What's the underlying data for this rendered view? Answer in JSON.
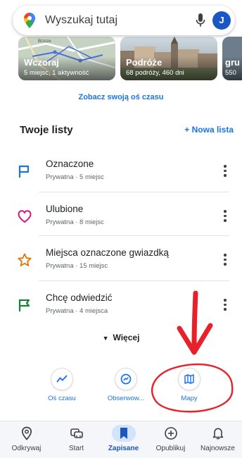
{
  "search": {
    "placeholder": "Wyszukaj tutaj",
    "avatar_letter": "J"
  },
  "timeline_cards": [
    {
      "title": "Wczoraj",
      "subtitle": "5 miejsc, 1 aktywność"
    },
    {
      "title": "Podróże",
      "subtitle": "68 podróży, 460 dni"
    },
    {
      "title": "gru",
      "subtitle": "550"
    }
  ],
  "map_thumbnail_label": "Brzoze",
  "timeline_link": "Zobacz swoją oś czasu",
  "lists": {
    "title": "Twoje listy",
    "new_list": "+ Nowa lista",
    "items": [
      {
        "name": "Oznaczone",
        "meta": "Prywatna · 5 miejsc",
        "icon": "flag-outline-icon",
        "color": "#1a73e8"
      },
      {
        "name": "Ulubione",
        "meta": "Prywatna · 8 miejsc",
        "icon": "heart-icon",
        "color": "#d01884"
      },
      {
        "name": "Miejsca oznaczone gwiazdką",
        "meta": "Prywatna · 15 miejsc",
        "icon": "star-icon",
        "color": "#e37400"
      },
      {
        "name": "Chcę odwiedzić",
        "meta": "Prywatna · 4 miejsca",
        "icon": "green-flag-icon",
        "color": "#188038"
      }
    ]
  },
  "more_label": "Więcej",
  "quick_actions": [
    {
      "label": "Oś czasu",
      "icon": "timeline-icon"
    },
    {
      "label": "Obserwow...",
      "icon": "follow-icon"
    },
    {
      "label": "Mapy",
      "icon": "map-icon"
    }
  ],
  "bottom_nav": [
    {
      "label": "Odkrywaj",
      "icon": "pin-icon",
      "active": false
    },
    {
      "label": "Start",
      "icon": "car-icon",
      "active": false
    },
    {
      "label": "Zapisane",
      "icon": "bookmark-icon",
      "active": true
    },
    {
      "label": "Opublikuj",
      "icon": "plus-circle-icon",
      "active": false
    },
    {
      "label": "Najnowsze",
      "icon": "bell-icon",
      "active": false
    }
  ],
  "colors": {
    "accent": "#1a73e8",
    "annotation": "#e8202a",
    "active_nav_bg": "#d2e3fc"
  }
}
